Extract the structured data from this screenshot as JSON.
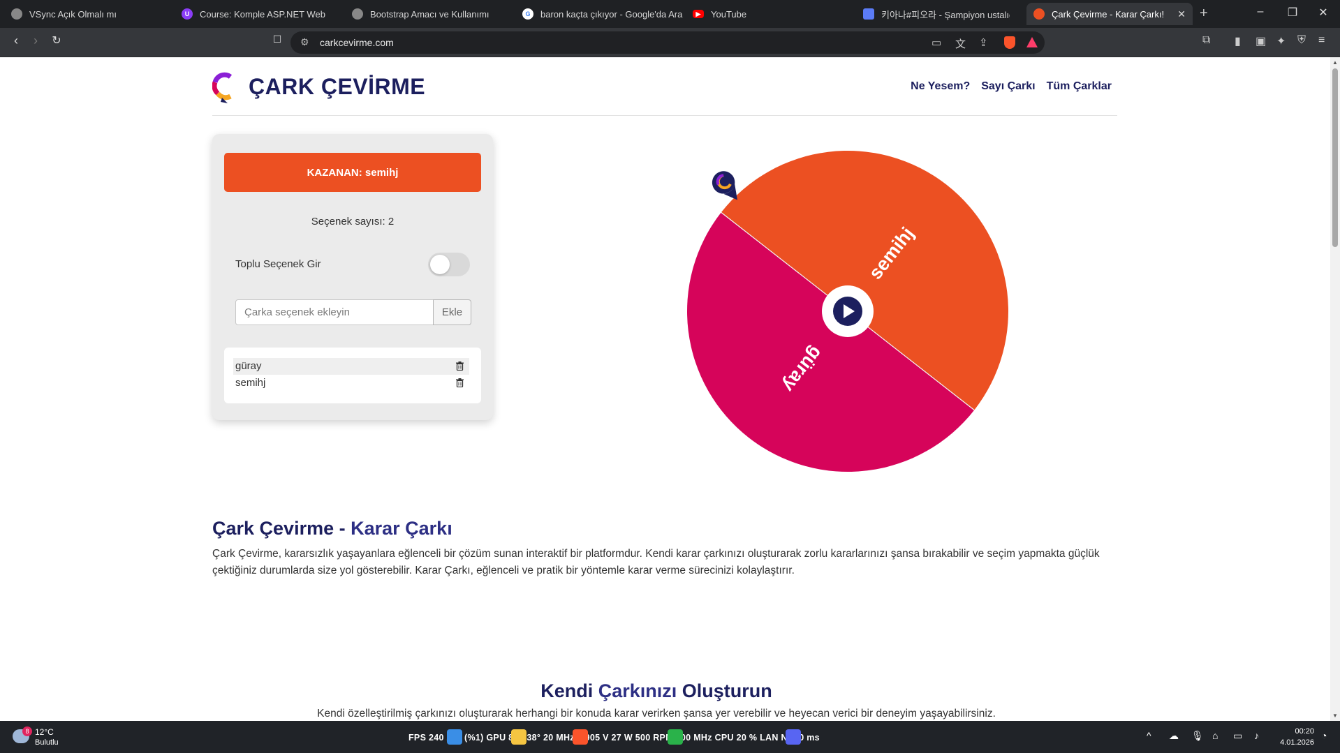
{
  "browser": {
    "tabs": [
      {
        "title": "VSync Açık Olmalı mı",
        "color": "#aaaaaa"
      },
      {
        "title": "Course: Komple ASP.NET Web Geliştirme",
        "color": "#8b3df7"
      },
      {
        "title": "Bootstrap Amacı ve Kullanımı",
        "color": "#aaaaaa"
      },
      {
        "title": "baron kaçta çıkıyor - Google'da Ara",
        "color": "#4285f4"
      },
      {
        "title": "YouTube",
        "color": "#ff0000"
      },
      {
        "title": "키아나#피오라 - Şampiyon ustalığı",
        "color": "#5b7cf7"
      },
      {
        "title": "Çark Çevirme - Karar Çarkı!",
        "color": "#ec5022"
      }
    ],
    "url": "carkcevirme.com"
  },
  "site": {
    "brand": "ÇARK ÇEVİRME",
    "nav": [
      "Ne Yesem?",
      "Sayı Çarkı",
      "Tüm Çarklar"
    ],
    "winner": "KAZANAN: semihj",
    "option_count": "Seçenek sayısı: 2",
    "bulk_toggle_label": "Toplu Seçenek Gir",
    "bulk_enabled": false,
    "input_placeholder": "Çarka seçenek ekleyin",
    "add_button": "Ekle",
    "options": [
      "güray",
      "semihj"
    ],
    "wheel": {
      "segments": [
        {
          "label": "semihj",
          "color": "#ec5022"
        },
        {
          "label": "güray",
          "color": "#d6045a"
        }
      ],
      "center_icon": "play-icon"
    },
    "section1": {
      "title_a": "Çark Çevirme",
      "title_sep": " - ",
      "title_b": "Karar Çarkı",
      "text": "Çark Çevirme, kararsızlık yaşayanlara eğlenceli bir çözüm sunan interaktif bir platformdur. Kendi karar çarkınızı oluşturarak zorlu kararlarınızı şansa bırakabilir ve seçim yapmakta güçlük çektiğiniz durumlarda size yol gösterebilir. Karar Çarkı, eğlenceli ve pratik bir yöntemle karar verme sürecinizi kolaylaştırır."
    },
    "section2": {
      "title_a": "Kendi ",
      "title_b": "Çarkınızı",
      "title_c": " Oluşturun",
      "text": "Kendi özelleştirilmiş çarkınızı oluşturarak herhangi bir konuda karar verirken şansa yer verebilir ve heyecan verici bir deneyim yaşayabilirsiniz."
    }
  },
  "taskbar": {
    "weather_temp": "12°C",
    "weather_desc": "Bulutlu",
    "weather_badge": "8",
    "stats": "FPS  240   238 (%1)   GPU  8 %   38°   20   MHz  0.905 V   27 W   500 RPM   700   MHz   CPU  20 %   LAN  N/A   0 ms",
    "time": "00:20",
    "date": "4.01.2026"
  }
}
